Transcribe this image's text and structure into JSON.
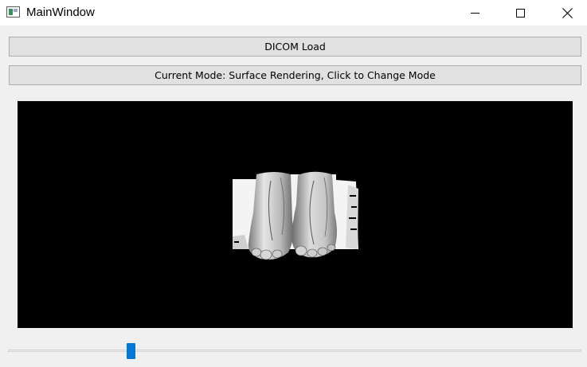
{
  "window": {
    "title": "MainWindow",
    "controls": [
      "minimize",
      "maximize",
      "close"
    ]
  },
  "buttons": {
    "dicom_load_label": "DICOM Load",
    "mode_label": "Current Mode: Surface Rendering, Click to Change Mode"
  },
  "render_view": {
    "background": "#000000",
    "content": "surface rendering of feet (grayscale)"
  },
  "slider": {
    "value_fraction": 0.21,
    "accent": "#0078d7"
  }
}
